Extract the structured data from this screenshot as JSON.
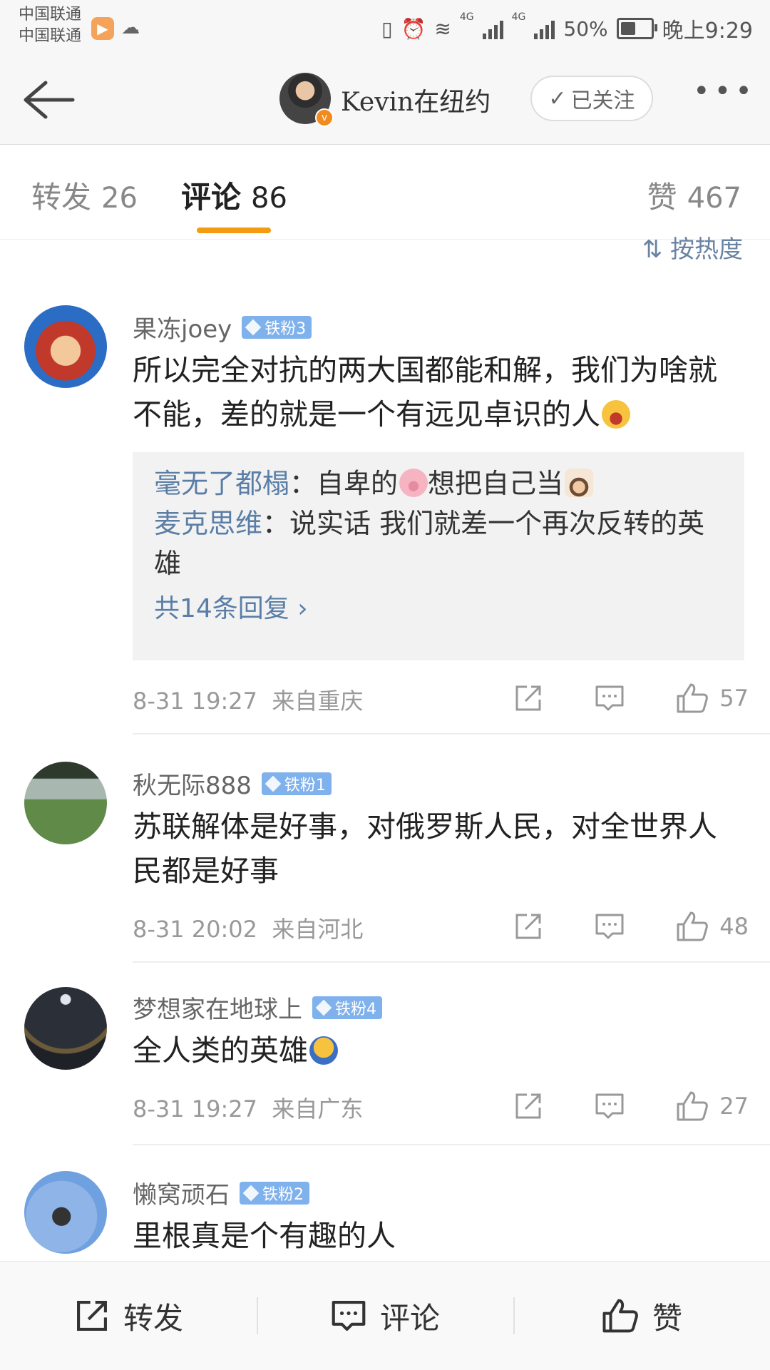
{
  "status_bar": {
    "carrier1": "中国联通",
    "carrier2": "中国联通",
    "network1": "4G",
    "network2": "4G",
    "battery": "50%",
    "battery_level": 0.5,
    "time": "晚上9:29"
  },
  "header": {
    "user_name": "Kevin在纽约",
    "follow_label": "已关注",
    "more_label": "•••"
  },
  "tabs": [
    {
      "label": "转发",
      "count": "26"
    },
    {
      "label": "评论",
      "count": "86"
    },
    {
      "label": "赞",
      "count": "467"
    }
  ],
  "sort_label": "按热度",
  "comments": [
    {
      "user": "果冻joey",
      "badge": "铁粉3",
      "text": "所以完全对抗的两大国都能和解，我们为啥就不能，差的就是一个有远见卓识的人",
      "replies": [
        {
          "name": "毫无了都榻",
          "text": "自卑的",
          "text2": "想把自己当"
        },
        {
          "name": "麦克思维",
          "text": "说实话 我们就差一个再次反转的英雄"
        }
      ],
      "more_replies": "共14条回复",
      "time": "8-31 19:27",
      "location": "来自重庆",
      "likes": "57"
    },
    {
      "user": "秋无际888",
      "badge": "铁粉1",
      "text": "苏联解体是好事，对俄罗斯人民，对全世界人民都是好事",
      "time": "8-31 20:02",
      "location": "来自河北",
      "likes": "48"
    },
    {
      "user": "梦想家在地球上",
      "badge": "铁粉4",
      "text": "全人类的英雄",
      "time": "8-31 19:27",
      "location": "来自广东",
      "likes": "27"
    },
    {
      "user": "懒窝顽石",
      "badge": "铁粉2",
      "text": "里根真是个有趣的人"
    }
  ],
  "bottom_bar": {
    "repost": "转发",
    "comment": "评论",
    "like": "赞"
  },
  "colors": {
    "accent_orange": "#f39c12",
    "link_blue": "#5b7ea6",
    "badge_blue": "#7fb1ec"
  }
}
